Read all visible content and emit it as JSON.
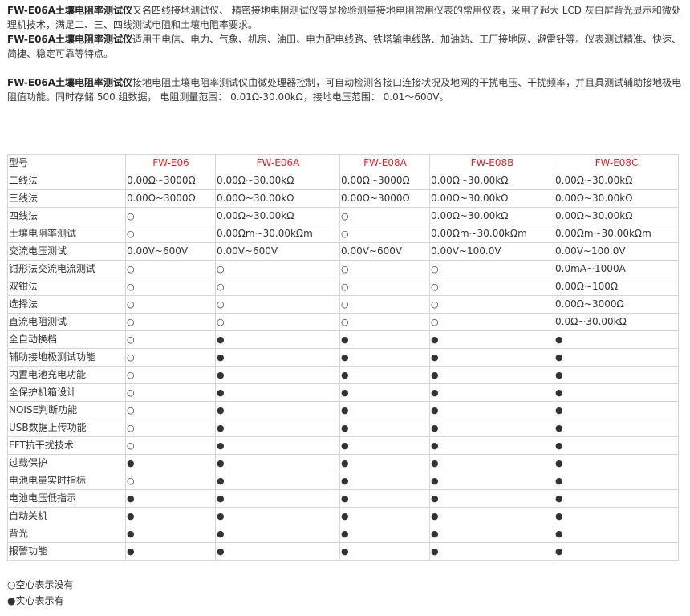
{
  "intro": {
    "p1_bold": "FW-E06A土壤电阻率测试仪",
    "p1_text": "又名四线接地测试仪、 精密接地电阻测试仪等是检验测量接地电阻常用仪表的常用仪表，采用了超大 LCD 灰白屏背光显示和微处理机技术，满足二、三、四线测试电阻和土壤电阻率要求。",
    "p2_bold": "FW-E06A土壤电阻率测试仪",
    "p2_text": "适用于电信、电力、气象、机房、油田、电力配电线路、铁塔输电线路、加油站、工厂接地网、避雷针等。仪表测试精准、快速、简捷、稳定可靠等特点。",
    "p3_bold": "FW-E06A土壤电阻率测试仪",
    "p3_text": "接地电阻土壤电阻率测试仪由微处理器控制，可自动检测各接口连接状况及地网的干扰电压、干扰频率，并且具测试辅助接地极电阻值功能。同时存储 500 组数据， 电阻测量范围： 0.01Ω-30.00kΩ，接地电压范围： 0.01～600V。"
  },
  "table": {
    "header_label": "型号",
    "models": [
      "FW-E06",
      "FW-E06A",
      "FW-E08A",
      "FW-E08B",
      "FW-E08C"
    ],
    "rows": [
      {
        "label": "二线法",
        "cells": [
          "0.00Ω~3000Ω",
          "0.00Ω~30.00kΩ",
          "0.00Ω~3000Ω",
          "0.00Ω~30.00kΩ",
          "0.00Ω~30.00kΩ"
        ]
      },
      {
        "label": "三线法",
        "cells": [
          "0.00Ω~3000Ω",
          "0.00Ω~30.00kΩ",
          "0.00Ω~3000Ω",
          "0.00Ω~30.00kΩ",
          "0.00Ω~30.00kΩ"
        ]
      },
      {
        "label": "四线法",
        "cells": [
          "○",
          "0.00Ω~30.00kΩ",
          "○",
          "0.00Ω~30.00kΩ",
          "0.00Ω~30.00kΩ"
        ]
      },
      {
        "label": "土壤电阻率测试",
        "cells": [
          "○",
          "0.00Ωm~30.00kΩm",
          "○",
          "0.00Ωm~30.00kΩm",
          "0.00Ωm~30.00kΩm"
        ]
      },
      {
        "label": "交流电压测试",
        "cells": [
          "0.00V~600V",
          "0.00V~600V",
          "0.00V~600V",
          "0.00V~100.0V",
          "0.00V~100.0V"
        ]
      },
      {
        "label": "钳形法交流电流测试",
        "cells": [
          "○",
          "○",
          "○",
          "○",
          "0.0mA~1000A"
        ]
      },
      {
        "label": "双钳法",
        "cells": [
          "○",
          "○",
          "○",
          "○",
          "0.00Ω~100Ω"
        ]
      },
      {
        "label": "选择法",
        "cells": [
          "○",
          "○",
          "○",
          "○",
          "0.00Ω~3000Ω"
        ]
      },
      {
        "label": "直流电阻测试",
        "cells": [
          "○",
          "○",
          "○",
          "○",
          "0.0Ω~30.00kΩ"
        ]
      },
      {
        "label": "全自动换档",
        "cells": [
          "○",
          "●",
          "●",
          "●",
          "●"
        ]
      },
      {
        "label": "辅助接地极测试功能",
        "cells": [
          "○",
          "●",
          "●",
          "●",
          "●"
        ]
      },
      {
        "label": "内置电池充电功能",
        "cells": [
          "○",
          "●",
          "●",
          "●",
          "●"
        ]
      },
      {
        "label": "全保护机箱设计",
        "cells": [
          "○",
          "●",
          "●",
          "●",
          "●"
        ]
      },
      {
        "label": "NOISE判断功能",
        "cells": [
          "○",
          "●",
          "●",
          "●",
          "●"
        ]
      },
      {
        "label": "USB数据上传功能",
        "cells": [
          "○",
          "●",
          "●",
          "●",
          "●"
        ]
      },
      {
        "label": "FFT抗干扰技术",
        "cells": [
          "○",
          "●",
          "●",
          "●",
          "●"
        ]
      },
      {
        "label": "过载保护",
        "cells": [
          "●",
          "●",
          "●",
          "●",
          "●"
        ]
      },
      {
        "label": "电池电量实时指标",
        "cells": [
          "○",
          "●",
          "●",
          "●",
          "●"
        ]
      },
      {
        "label": "电池电压低指示",
        "cells": [
          "●",
          "●",
          "●",
          "●",
          "●"
        ]
      },
      {
        "label": "自动关机",
        "cells": [
          "●",
          "●",
          "●",
          "●",
          "●"
        ]
      },
      {
        "label": "背光",
        "cells": [
          "●",
          "●",
          "●",
          "●",
          "●"
        ]
      },
      {
        "label": "报警功能",
        "cells": [
          "●",
          "●",
          "●",
          "●",
          "●"
        ]
      }
    ]
  },
  "legend": {
    "hollow": "○空心表示没有",
    "solid": "●实心表示有"
  },
  "colors": {
    "model_header": "#e8212a",
    "border": "#d6d6d6"
  }
}
